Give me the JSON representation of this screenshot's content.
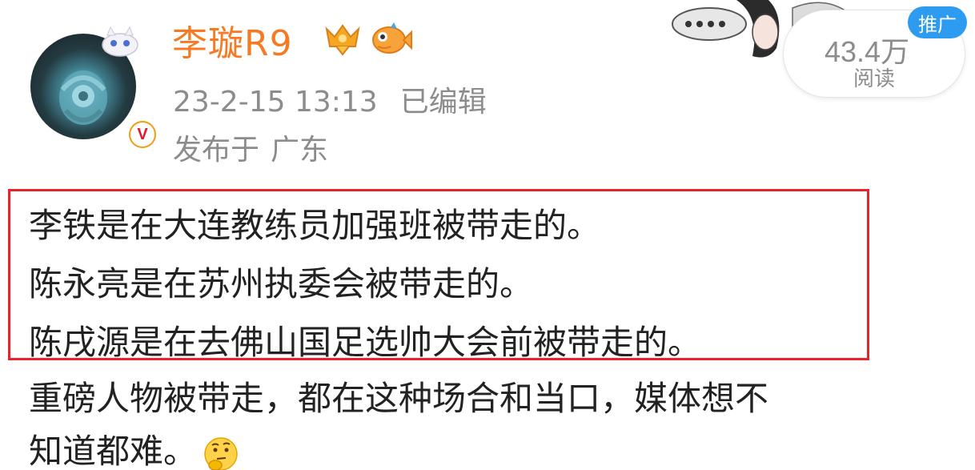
{
  "post": {
    "username": "李璇R9",
    "timestamp": "23-2-15 13:13",
    "edited_label": "已编辑",
    "published_prefix": "发布于",
    "location": "广东",
    "reads_count": "43.4万",
    "reads_label": "阅读",
    "promo_label": "推广",
    "highlighted_lines": [
      "李铁是在大连教练员加强班被带走的。",
      "陈永亮是在苏州执委会被带走的。",
      "陈戌源是在去佛山国足选帅大会前被带走的。"
    ],
    "body_lines": [
      "重磅人物被带走，都在这种场合和当口，媒体想不",
      "知道都难。"
    ]
  },
  "icons": {
    "verified": "verified-v-badge-icon",
    "crown": "crown-medal-icon",
    "fish": "fish-badge-icon",
    "emoji": "thinking-face-emoji"
  },
  "colors": {
    "username": "#f57a23",
    "meta_text": "#8c8c8c",
    "highlight_border": "#e8242a",
    "promo_bg": "#2d9cf0",
    "body_text": "#222222"
  }
}
